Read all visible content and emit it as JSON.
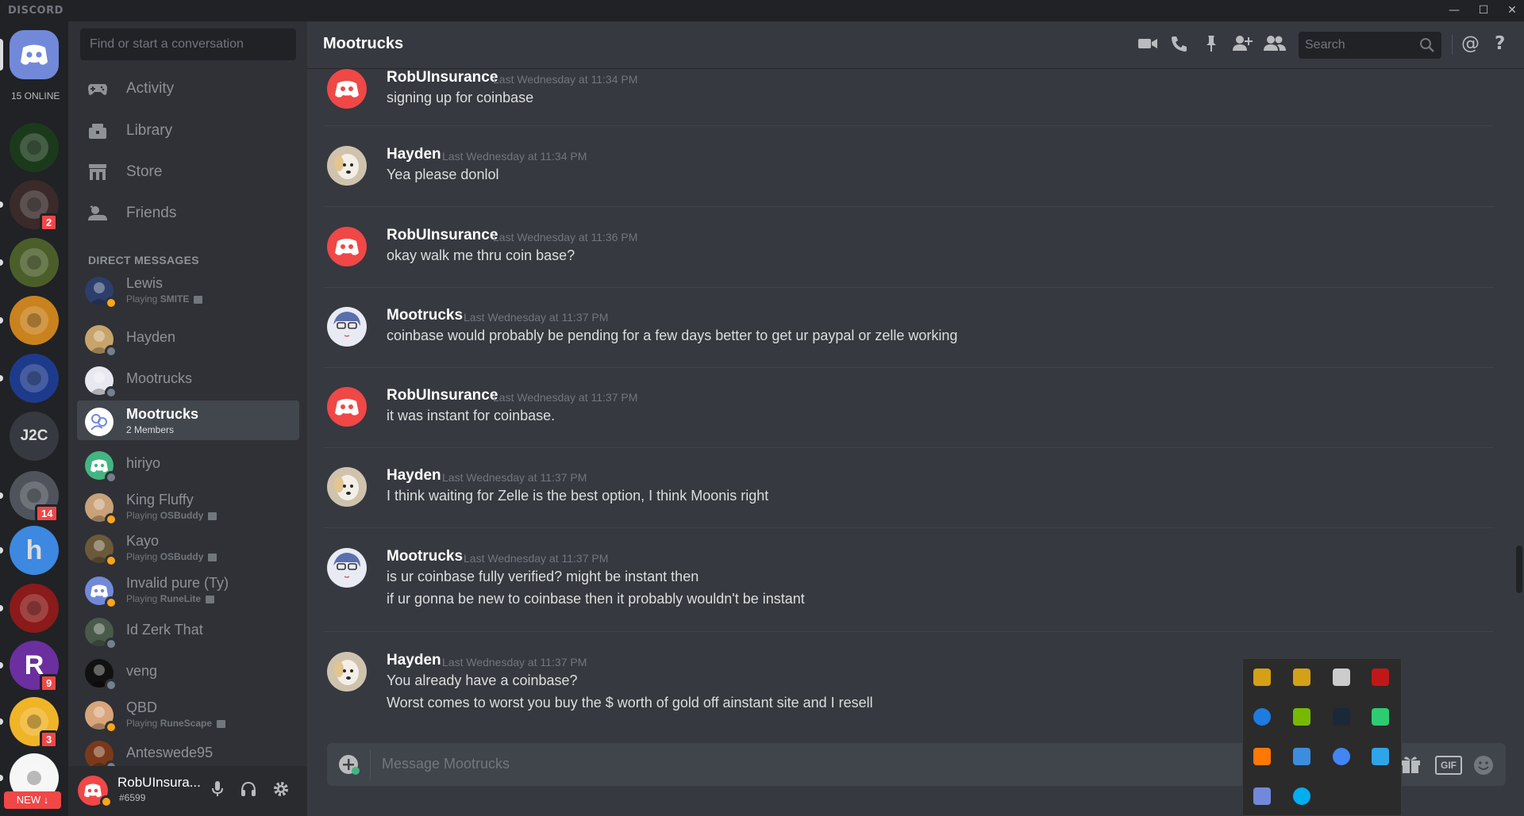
{
  "window": {
    "brand": "DISCORD",
    "min": "—",
    "max": "☐",
    "close": "✕"
  },
  "guilds": {
    "online_count": "15 ONLINE",
    "items": [
      {
        "name": "home",
        "badge": ""
      },
      {
        "name": "next-level",
        "badge": ""
      },
      {
        "name": "resident",
        "badge": "2"
      },
      {
        "name": "field",
        "badge": ""
      },
      {
        "name": "rune-treasure",
        "badge": ""
      },
      {
        "name": "rungold",
        "badge": ""
      },
      {
        "name": "j2c",
        "text": "J2C",
        "badge": ""
      },
      {
        "name": "arrow",
        "badge": "14"
      },
      {
        "name": "h",
        "text": "h",
        "badge": ""
      },
      {
        "name": "compass",
        "badge": ""
      },
      {
        "name": "r",
        "text": "R",
        "badge": "9"
      },
      {
        "name": "paw",
        "badge": "3"
      },
      {
        "name": "new",
        "badge": ""
      }
    ],
    "new_label": "NEW ↓"
  },
  "sidebar": {
    "search_placeholder": "Find or start a conversation",
    "nav": [
      {
        "label": "Activity",
        "icon": "gamepad-icon"
      },
      {
        "label": "Library",
        "icon": "library-icon"
      },
      {
        "label": "Store",
        "icon": "store-icon"
      },
      {
        "label": "Friends",
        "icon": "friends-icon"
      }
    ],
    "dm_header": "DIRECT MESSAGES",
    "dms": [
      {
        "name": "Lewis",
        "sub_prefix": "Playing ",
        "sub_game": "SMITE",
        "status": "#faa61a"
      },
      {
        "name": "Hayden",
        "sub_prefix": "",
        "sub_game": "",
        "status": "#747f8d"
      },
      {
        "name": "Mootrucks",
        "sub_prefix": "",
        "sub_game": "",
        "status": "#747f8d"
      },
      {
        "name": "Mootrucks",
        "sub_prefix": "2 Members",
        "sub_game": "",
        "status": ""
      },
      {
        "name": "hiriyo",
        "sub_prefix": "",
        "sub_game": "",
        "status": "#747f8d"
      },
      {
        "name": "King Fluffy",
        "sub_prefix": "Playing ",
        "sub_game": "OSBuddy",
        "status": "#faa61a"
      },
      {
        "name": "Kayo",
        "sub_prefix": "Playing ",
        "sub_game": "OSBuddy",
        "status": "#faa61a"
      },
      {
        "name": "Invalid pure (Ty)",
        "sub_prefix": "Playing ",
        "sub_game": "RuneLite",
        "status": "#faa61a"
      },
      {
        "name": "Id Zerk That",
        "sub_prefix": "",
        "sub_game": "",
        "status": "#747f8d"
      },
      {
        "name": "veng",
        "sub_prefix": "",
        "sub_game": "",
        "status": "#747f8d"
      },
      {
        "name": "QBD",
        "sub_prefix": "Playing ",
        "sub_game": "RuneScape",
        "status": "#faa61a"
      },
      {
        "name": "Anteswede95",
        "sub_prefix": "",
        "sub_game": "",
        "status": "#747f8d"
      }
    ]
  },
  "user": {
    "name": "RobUInsura...",
    "tag": "#6599"
  },
  "header": {
    "title": "Mootrucks",
    "search_placeholder": "Search"
  },
  "messages": [
    {
      "author": "RobUInsurance",
      "time": "Last Wednesday at 11:34 PM",
      "avatar": "discord",
      "lines": [
        "signing up for coinbase"
      ]
    },
    {
      "author": "Hayden",
      "time": "Last Wednesday at 11:34 PM",
      "avatar": "dog",
      "lines": [
        "Yea please donlol"
      ]
    },
    {
      "author": "RobUInsurance",
      "time": "Last Wednesday at 11:36 PM",
      "avatar": "discord",
      "lines": [
        "okay walk me thru coin base?"
      ]
    },
    {
      "author": "Mootrucks",
      "time": "Last Wednesday at 11:37 PM",
      "avatar": "anime",
      "lines": [
        "coinbase would probably be pending for a few days better to get ur paypal or zelle working"
      ]
    },
    {
      "author": "RobUInsurance",
      "time": "Last Wednesday at 11:37 PM",
      "avatar": "discord",
      "lines": [
        "it was instant for coinbase."
      ]
    },
    {
      "author": "Hayden",
      "time": "Last Wednesday at 11:37 PM",
      "avatar": "dog",
      "lines": [
        "I think waiting for Zelle is the best option, I think Moonis right"
      ]
    },
    {
      "author": "Mootrucks",
      "time": "Last Wednesday at 11:37 PM",
      "avatar": "anime",
      "lines": [
        "is ur coinbase fully verified? might be instant then",
        "if ur gonna be new to coinbase then it probably wouldn't be instant"
      ]
    },
    {
      "author": "Hayden",
      "time": "Last Wednesday at 11:37 PM",
      "avatar": "dog",
      "lines": [
        "You already have a coinbase?",
        "Worst comes to worst you buy the $ worth of gold off  ainstant site and I resell"
      ]
    }
  ],
  "composer": {
    "placeholder": "Message Mootrucks",
    "gif": "GIF"
  },
  "tray": {
    "icons": [
      "runelite-icon",
      "runelite-icon",
      "tray-app-icon",
      "mcafee-icon",
      "bluetooth-icon",
      "nvidia-icon",
      "steam-icon",
      "refresh-app-icon",
      "avast-icon",
      "dots-app-icon",
      "chrome-icon",
      "display-icon",
      "discord-icon",
      "skype-icon"
    ]
  }
}
